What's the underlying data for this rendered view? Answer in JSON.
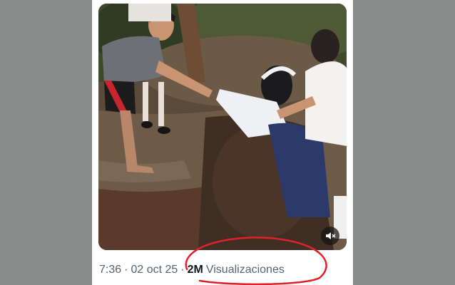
{
  "post": {
    "time": "7:36",
    "separator": "·",
    "date": "02 oct 25",
    "views_count": "2M",
    "views_label": "Visualizaciones"
  },
  "video": {
    "mute_icon": "speaker-muted-icon"
  },
  "colors": {
    "annotation_circle": "#e0212b",
    "meta_text": "#536471",
    "views_count_text": "#0f1419",
    "page_background": "#8a8c8b"
  }
}
